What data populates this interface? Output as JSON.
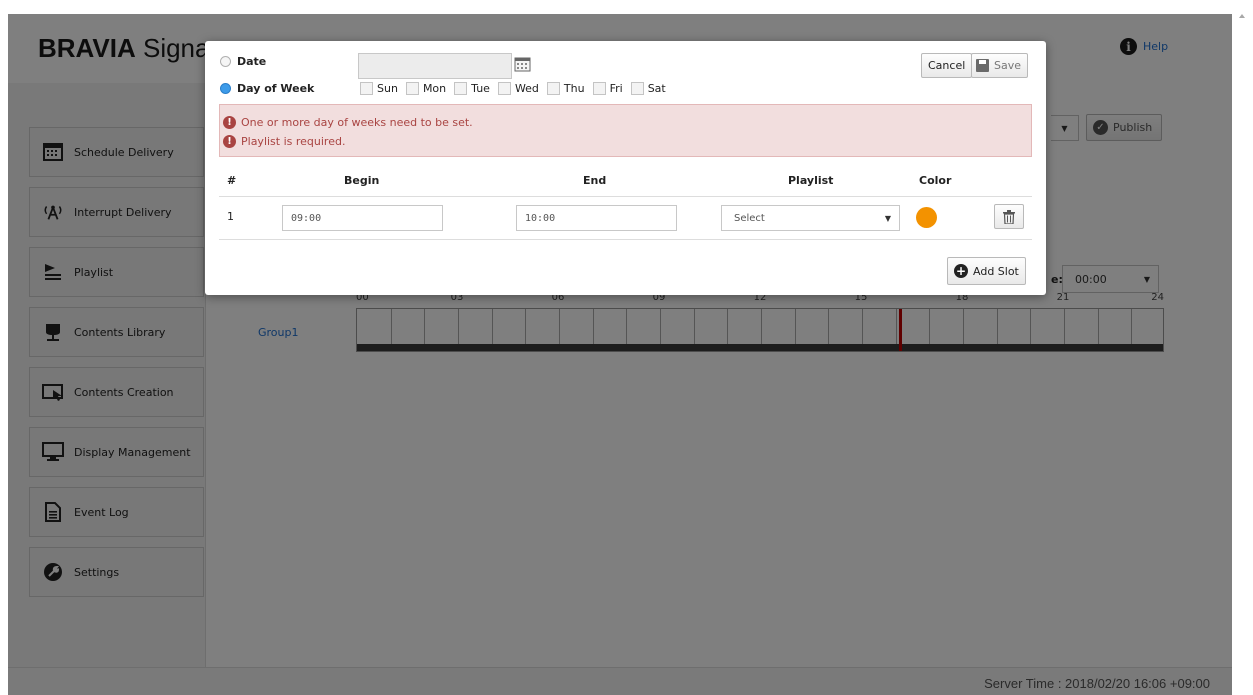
{
  "app": {
    "brand_bold": "BRAVIA",
    "brand_rest": " Signa"
  },
  "header": {
    "help_label": "Help"
  },
  "sidebar": {
    "items": [
      {
        "label": "Schedule Delivery",
        "icon": "calendar-icon"
      },
      {
        "label": "Interrupt Delivery",
        "icon": "broadcast-icon"
      },
      {
        "label": "Playlist",
        "icon": "playlist-icon"
      },
      {
        "label": "Contents Library",
        "icon": "library-icon"
      },
      {
        "label": "Contents Creation",
        "icon": "creation-icon"
      },
      {
        "label": "Display Management",
        "icon": "monitor-icon"
      },
      {
        "label": "Event Log",
        "icon": "document-icon"
      },
      {
        "label": "Settings",
        "icon": "wrench-icon"
      }
    ]
  },
  "main": {
    "publish_label": "Publish",
    "time_label_partial": "e:",
    "time_value": "00:00",
    "group": "Group1",
    "hours": [
      "00",
      "03",
      "06",
      "09",
      "12",
      "15",
      "18",
      "21",
      "24"
    ],
    "current_hour": 16.1
  },
  "footer": {
    "server_time": "Server Time : 2018/02/20 16:06 +09:00"
  },
  "modal": {
    "date_label": "Date",
    "dow_label": "Day of Week",
    "selected_mode": "Day of Week",
    "date_value": "",
    "days": [
      "Sun",
      "Mon",
      "Tue",
      "Wed",
      "Thu",
      "Fri",
      "Sat"
    ],
    "cancel_label": "Cancel",
    "save_label": "Save",
    "errors": [
      "One or more day of weeks need to be set.",
      "Playlist is required."
    ],
    "columns": {
      "num": "#",
      "begin": "Begin",
      "end": "End",
      "playlist": "Playlist",
      "color": "Color"
    },
    "slots": [
      {
        "num": "1",
        "begin": "09:00",
        "end": "10:00",
        "playlist": "Select",
        "color": "#f39200"
      }
    ],
    "add_slot_label": "Add Slot"
  }
}
